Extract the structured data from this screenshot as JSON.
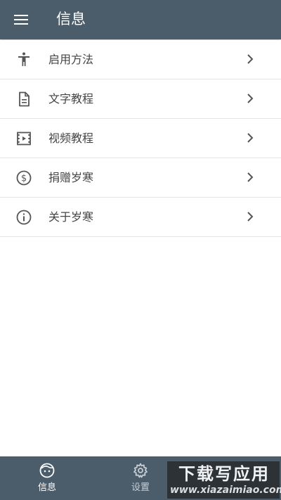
{
  "appbar": {
    "title": "信息",
    "menu_icon": "menu-icon"
  },
  "list": {
    "items": [
      {
        "label": "启用方法",
        "icon": "accessibility-icon"
      },
      {
        "label": "文字教程",
        "icon": "document-icon"
      },
      {
        "label": "视频教程",
        "icon": "video-icon"
      },
      {
        "label": "捐赠岁寒",
        "icon": "dollar-icon"
      },
      {
        "label": "关于岁寒",
        "icon": "info-icon"
      }
    ]
  },
  "bottom_nav": {
    "tabs": [
      {
        "label": "信息",
        "icon": "face-icon",
        "active": true
      },
      {
        "label": "设置",
        "icon": "gear-icon",
        "active": false
      }
    ]
  },
  "watermark": {
    "text_cn": "下载写应用",
    "url": "www.xiazaimiao.com"
  },
  "colors": {
    "primary": "#4b5d6b",
    "text": "#444444",
    "divider": "#e3e3e3",
    "background": "#ffffff"
  }
}
